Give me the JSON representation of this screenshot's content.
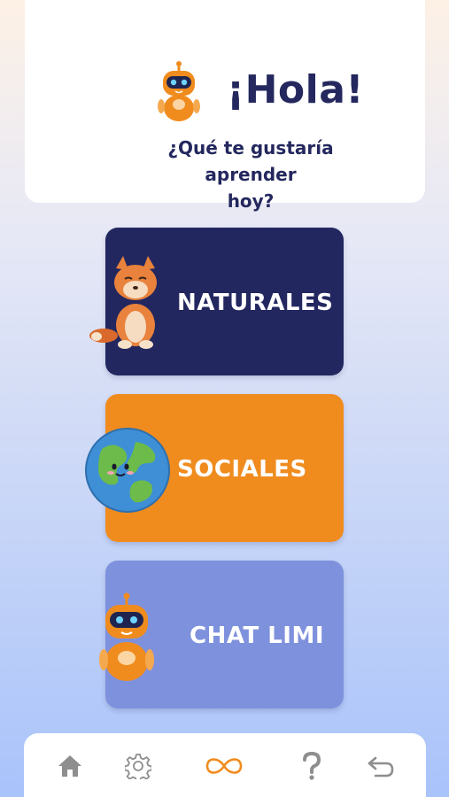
{
  "header": {
    "greeting": "¡Hola!",
    "question_line1": "¿Qué te gustaría aprender",
    "question_line2": "hoy?"
  },
  "subjects": [
    {
      "label": "NATURALES",
      "icon": "fox-icon",
      "color": "#232760"
    },
    {
      "label": "SOCIALES",
      "icon": "earth-globe-icon",
      "color": "#f08c1e"
    },
    {
      "label": "CHAT LIMI",
      "icon": "robot-icon",
      "color": "#7e91dd"
    }
  ],
  "nav": [
    {
      "icon": "home-icon"
    },
    {
      "icon": "gear-icon"
    },
    {
      "icon": "infinity-icon",
      "active": true,
      "color": "#f08c1e"
    },
    {
      "icon": "question-icon"
    },
    {
      "icon": "back-arrow-icon"
    }
  ],
  "colors": {
    "primary": "#24285e",
    "accent": "#f08c1e",
    "nav_icon": "#8e8e8e"
  }
}
